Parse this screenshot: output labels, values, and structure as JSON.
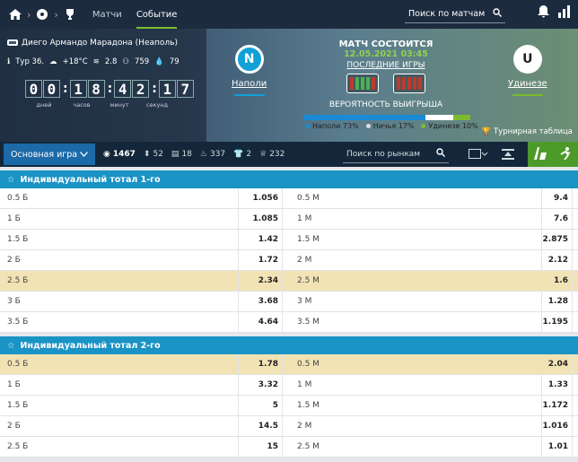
{
  "nav": {
    "matches": "Матчи",
    "event": "Событие",
    "search_placeholder": "Поиск по матчам"
  },
  "event": {
    "venue": "Диего Армандо Марадона (Неаполь)",
    "round": "Тур 36.",
    "temperature": "+18°C",
    "wind": "2.8",
    "attendance": "759",
    "humidity": "79",
    "timer": [
      "0",
      "0",
      "1",
      "8",
      "4",
      "2",
      "1",
      "7"
    ],
    "timer_labels": [
      "дней",
      "часов",
      "минут",
      "секунд"
    ],
    "status": "МАТЧ СОСТОИТСЯ",
    "datetime": "12.05.2021 03:45",
    "last_games": "ПОСЛЕДНИЕ ИГРЫ",
    "win_prob_title": "ВЕРОЯТНОСТЬ ВЫИГРЫША",
    "home": {
      "name": "Наполи",
      "logo": "N",
      "color": "#12a0d7",
      "form": [
        "#c0392b",
        "#4caf50",
        "#4caf50",
        "#4caf50",
        "#c0392b"
      ]
    },
    "away": {
      "name": "Удинезе",
      "logo": "U",
      "color": "#222",
      "form": [
        "#c0392b",
        "#c0392b",
        "#c0392b",
        "#c0392b",
        "#c0392b"
      ]
    },
    "probabilities": [
      {
        "label": "Наполи 73%",
        "value": 73,
        "color": "#1a8ad4"
      },
      {
        "label": "Ничья 17%",
        "value": 17,
        "color": "#ffffff"
      },
      {
        "label": "Удинезе 10%",
        "value": 10,
        "color": "#7dbb2c"
      }
    ],
    "standings": "Турнирная таблица"
  },
  "filters": {
    "main_select": "Основная игра",
    "counts": [
      {
        "icon": "target-icon",
        "value": "1467"
      },
      {
        "icon": "corner-icon",
        "value": "52"
      },
      {
        "icon": "card-icon",
        "value": "18"
      },
      {
        "icon": "fire-icon",
        "value": "337"
      },
      {
        "icon": "shirt-icon",
        "value": "2"
      },
      {
        "icon": "trophy-icon",
        "value": "232"
      }
    ],
    "market_search": "Поиск по рынкам"
  },
  "sections": [
    {
      "title": "Индивидуальный тотал 1-го",
      "rows": [
        {
          "l1": "0.5 Б",
          "o1": "1.056",
          "l2": "0.5 М",
          "o2": "9.4",
          "hl": false
        },
        {
          "l1": "1 Б",
          "o1": "1.085",
          "l2": "1 М",
          "o2": "7.6",
          "hl": false
        },
        {
          "l1": "1.5 Б",
          "o1": "1.42",
          "l2": "1.5 М",
          "o2": "2.875",
          "hl": false
        },
        {
          "l1": "2 Б",
          "o1": "1.72",
          "l2": "2 М",
          "o2": "2.12",
          "hl": false
        },
        {
          "l1": "2.5 Б",
          "o1": "2.34",
          "l2": "2.5 М",
          "o2": "1.6",
          "hl": true
        },
        {
          "l1": "3 Б",
          "o1": "3.68",
          "l2": "3 М",
          "o2": "1.28",
          "hl": false
        },
        {
          "l1": "3.5 Б",
          "o1": "4.64",
          "l2": "3.5 М",
          "o2": "1.195",
          "hl": false
        }
      ]
    },
    {
      "title": "Индивидуальный тотал 2-го",
      "rows": [
        {
          "l1": "0.5 Б",
          "o1": "1.78",
          "l2": "0.5 М",
          "o2": "2.04",
          "hl": true
        },
        {
          "l1": "1 Б",
          "o1": "3.32",
          "l2": "1 М",
          "o2": "1.33",
          "hl": false
        },
        {
          "l1": "1.5 Б",
          "o1": "5",
          "l2": "1.5 М",
          "o2": "1.172",
          "hl": false
        },
        {
          "l1": "2 Б",
          "o1": "14.5",
          "l2": "2 М",
          "o2": "1.016",
          "hl": false
        },
        {
          "l1": "2.5 Б",
          "o1": "15",
          "l2": "2.5 М",
          "o2": "1.01",
          "hl": false
        }
      ]
    }
  ]
}
